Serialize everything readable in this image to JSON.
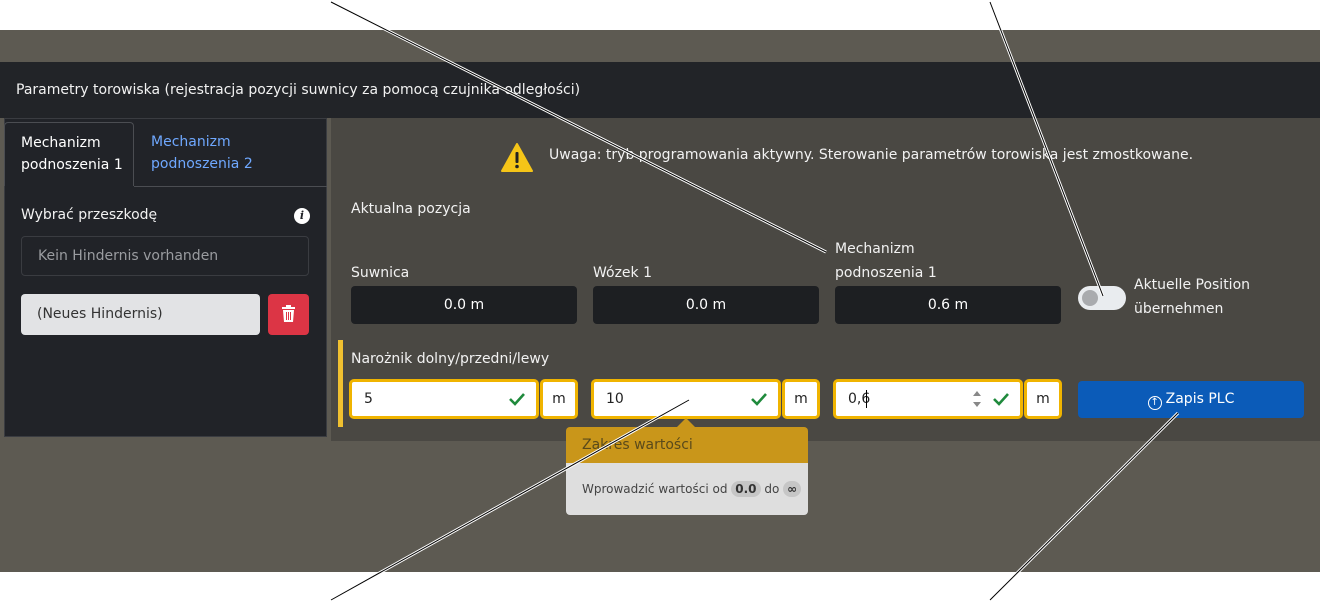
{
  "title": "Parametry torowiska (rejestracja pozycji suwnicy za pomocą czujnika odległości)",
  "tabs": [
    {
      "label_line1": "Mechanizm",
      "label_line2": "podnoszenia 1",
      "active": true
    },
    {
      "label_line1": "Mechanizm",
      "label_line2": "podnoszenia 2",
      "active": false
    }
  ],
  "sidebar": {
    "select_label": "Wybrać przeszkodę",
    "info_icon": "i",
    "no_obstacle": "Kein Hindernis vorhanden",
    "new_obstacle": "(Neues Hindernis)",
    "delete_icon": "trash-icon"
  },
  "warning": {
    "text": "Uwaga: tryb programowania aktywny. Sterowanie parametrów torowiska jest zmostkowane."
  },
  "current_position": {
    "heading": "Aktualna pozycja",
    "fields": [
      {
        "label": "Suwnica",
        "value": "0.0 m"
      },
      {
        "label": "Wózek 1",
        "value": "0.0 m"
      },
      {
        "label_line1": "Mechanizm",
        "label_line2": "podnoszenia 1",
        "value": "0.6 m"
      }
    ],
    "toggle_label_line1": "Aktuelle Position",
    "toggle_label_line2": "übernehmen",
    "toggle_on": false
  },
  "corner": {
    "heading": "Narożnik dolny/przedni/lewy",
    "inputs": [
      {
        "value": "5",
        "unit": "m"
      },
      {
        "value": "10",
        "unit": "m"
      },
      {
        "value": "0,6",
        "unit": "m"
      }
    ],
    "save_button": "Zapis PLC"
  },
  "tooltip": {
    "title": "Zakres wartości",
    "prefix": "Wprowadzić wartości od",
    "min": "0.0",
    "middle": "do",
    "max": "∞"
  },
  "colors": {
    "accent": "#f0b400",
    "primary": "#0b5bb8",
    "danger": "#dc3545",
    "success": "#1f8a3c"
  }
}
